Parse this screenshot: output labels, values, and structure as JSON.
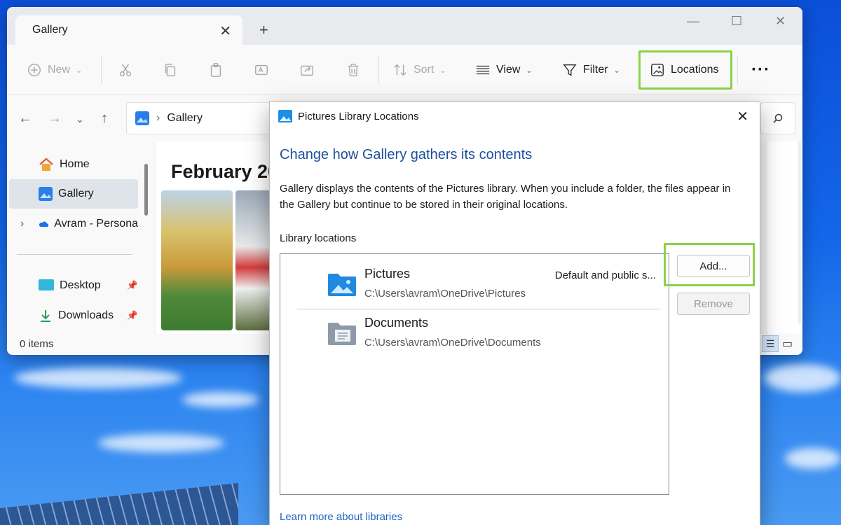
{
  "explorer": {
    "tab_title": "Gallery",
    "toolbar": {
      "new": "New",
      "sort": "Sort",
      "view": "View",
      "filter": "Filter",
      "locations": "Locations"
    },
    "breadcrumb": "Gallery",
    "sidebar": [
      {
        "label": "Home"
      },
      {
        "label": "Gallery"
      },
      {
        "label": "Avram - Persona"
      },
      {
        "label": "Desktop"
      },
      {
        "label": "Downloads"
      }
    ],
    "content_heading": "February 20",
    "status": "0 items"
  },
  "dialog": {
    "title": "Pictures Library Locations",
    "heading": "Change how Gallery gathers its contents",
    "description": "Gallery displays the contents of the Pictures library. When you include a folder, the files appear in the Gallery but continue to be stored in their original locations.",
    "section_label": "Library locations",
    "locations": [
      {
        "name": "Pictures",
        "path": "C:\\Users\\avram\\OneDrive\\Pictures",
        "tag": "Default and public s..."
      },
      {
        "name": "Documents",
        "path": "C:\\Users\\avram\\OneDrive\\Documents",
        "tag": ""
      }
    ],
    "add_label": "Add...",
    "remove_label": "Remove",
    "link": "Learn more about libraries"
  },
  "colors": {
    "accent_link": "#1e62c7",
    "heading_blue": "#1f4e9c",
    "highlight_green": "#8bd14a"
  }
}
